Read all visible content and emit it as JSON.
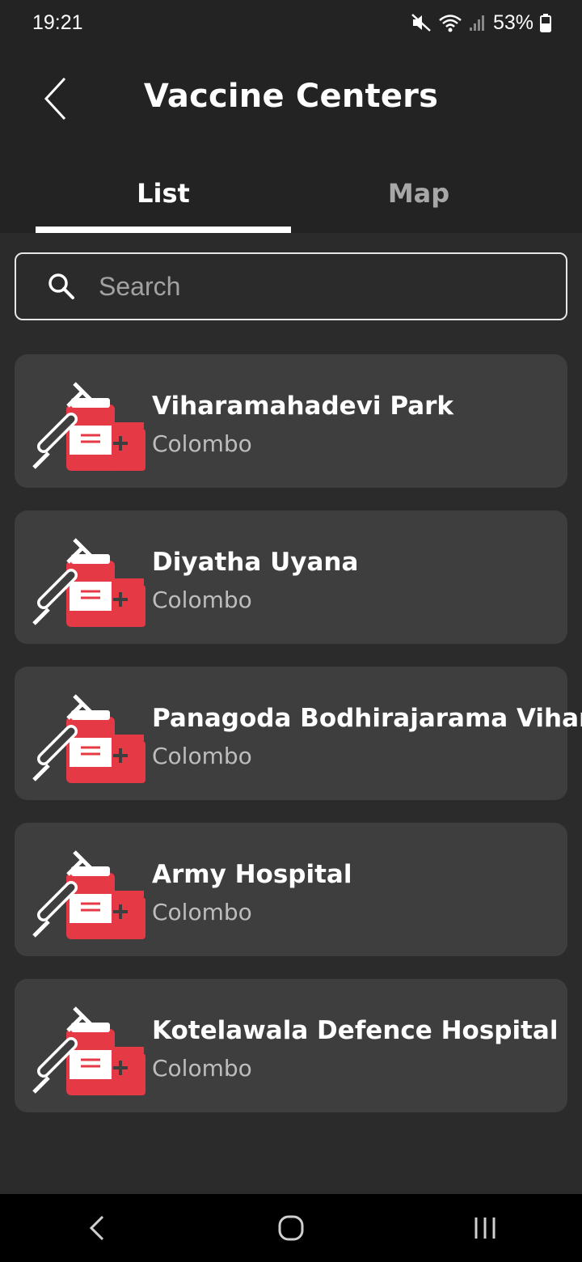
{
  "status": {
    "time": "19:21",
    "battery": "53%"
  },
  "header": {
    "title": "Vaccine Centers",
    "tabs": [
      {
        "label": "List",
        "active": true
      },
      {
        "label": "Map",
        "active": false
      }
    ]
  },
  "search": {
    "placeholder": "Search",
    "value": ""
  },
  "centers": [
    {
      "name": "Viharamahadevi Park",
      "city": "Colombo"
    },
    {
      "name": "Diyatha Uyana",
      "city": "Colombo"
    },
    {
      "name": "Panagoda Bodhirajarama Vihar",
      "city": "Colombo"
    },
    {
      "name": "Army Hospital",
      "city": "Colombo"
    },
    {
      "name": "Kotelawala Defence Hospital",
      "city": "Colombo"
    }
  ],
  "icons": {
    "back": "chevron-left-icon",
    "search": "search-icon",
    "center": "vaccine-syringe-vial-icon",
    "nav": [
      "nav-back-icon",
      "nav-home-icon",
      "nav-recents-icon"
    ]
  },
  "colors": {
    "accent": "#e53946",
    "card": "#3e3e3e",
    "background": "#2b2b2b"
  }
}
